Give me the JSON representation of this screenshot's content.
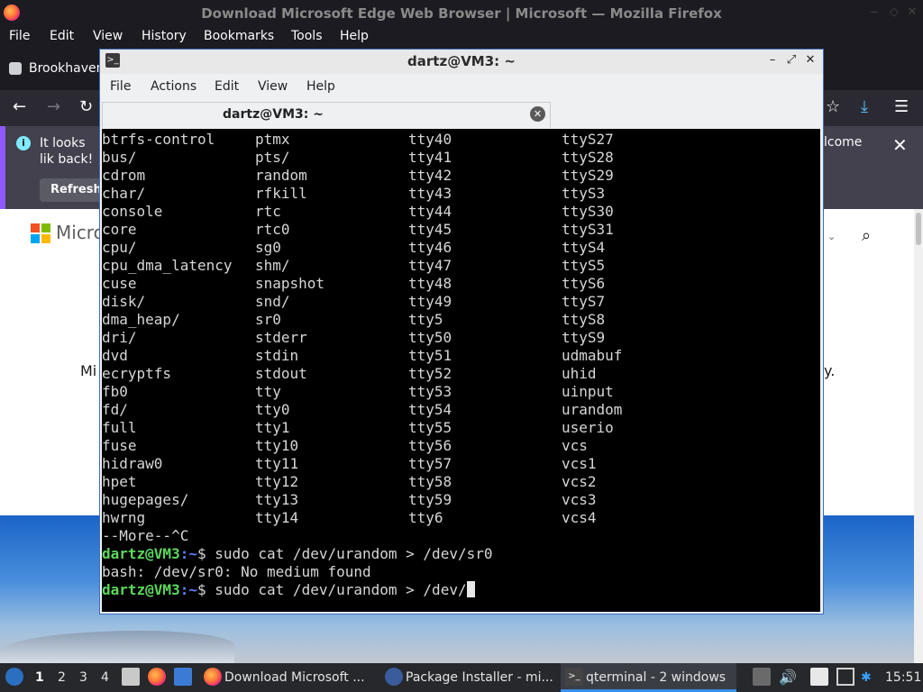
{
  "firefox": {
    "window_title": "Download Microsoft Edge Web Browser | Microsoft — Mozilla Firefox",
    "menu": [
      "File",
      "Edit",
      "View",
      "History",
      "Bookmarks",
      "Tools",
      "Help"
    ],
    "tab_label": "Brookhaven",
    "notice_left": "It looks lik back!",
    "notice_right": "lcome",
    "refresh_label": "Refresh",
    "page_logo_text": "Micro",
    "page_text_left": "Mi",
    "page_text_right": "y."
  },
  "terminal": {
    "window_title": "dartz@VM3: ~",
    "menu": [
      "File",
      "Actions",
      "Edit",
      "View",
      "Help"
    ],
    "tab_label": "dartz@VM3: ~",
    "listing": [
      [
        "btrfs-control",
        "ptmx",
        "tty40",
        "ttyS27"
      ],
      [
        "bus/",
        "pts/",
        "tty41",
        "ttyS28"
      ],
      [
        "cdrom",
        "random",
        "tty42",
        "ttyS29"
      ],
      [
        "char/",
        "rfkill",
        "tty43",
        "ttyS3"
      ],
      [
        "console",
        "rtc",
        "tty44",
        "ttyS30"
      ],
      [
        "core",
        "rtc0",
        "tty45",
        "ttyS31"
      ],
      [
        "cpu/",
        "sg0",
        "tty46",
        "ttyS4"
      ],
      [
        "cpu_dma_latency",
        "shm/",
        "tty47",
        "ttyS5"
      ],
      [
        "cuse",
        "snapshot",
        "tty48",
        "ttyS6"
      ],
      [
        "disk/",
        "snd/",
        "tty49",
        "ttyS7"
      ],
      [
        "dma_heap/",
        "sr0",
        "tty5",
        "ttyS8"
      ],
      [
        "dri/",
        "stderr",
        "tty50",
        "ttyS9"
      ],
      [
        "dvd",
        "stdin",
        "tty51",
        "udmabuf"
      ],
      [
        "ecryptfs",
        "stdout",
        "tty52",
        "uhid"
      ],
      [
        "fb0",
        "tty",
        "tty53",
        "uinput"
      ],
      [
        "fd/",
        "tty0",
        "tty54",
        "urandom"
      ],
      [
        "full",
        "tty1",
        "tty55",
        "userio"
      ],
      [
        "fuse",
        "tty10",
        "tty56",
        "vcs"
      ],
      [
        "hidraw0",
        "tty11",
        "tty57",
        "vcs1"
      ],
      [
        "hpet",
        "tty12",
        "tty58",
        "vcs2"
      ],
      [
        "hugepages/",
        "tty13",
        "tty59",
        "vcs3"
      ],
      [
        "hwrng",
        "tty14",
        "tty6",
        "vcs4"
      ]
    ],
    "more_line": "--More--^C",
    "prompt_user": "dartz@VM3",
    "prompt_path": ":~",
    "prompt_symbol": "$ ",
    "command1": "sudo cat /dev/urandom > /dev/sr0",
    "error_line": "bash: /dev/sr0: No medium found",
    "command2": "sudo cat /dev/urandom > /dev/"
  },
  "taskbar": {
    "workspaces": [
      "1",
      "2",
      "3",
      "4"
    ],
    "tasks": [
      "Download Microsoft ...",
      "Package Installer - mi...",
      "qterminal - 2 windows"
    ],
    "clock": "15:51"
  }
}
